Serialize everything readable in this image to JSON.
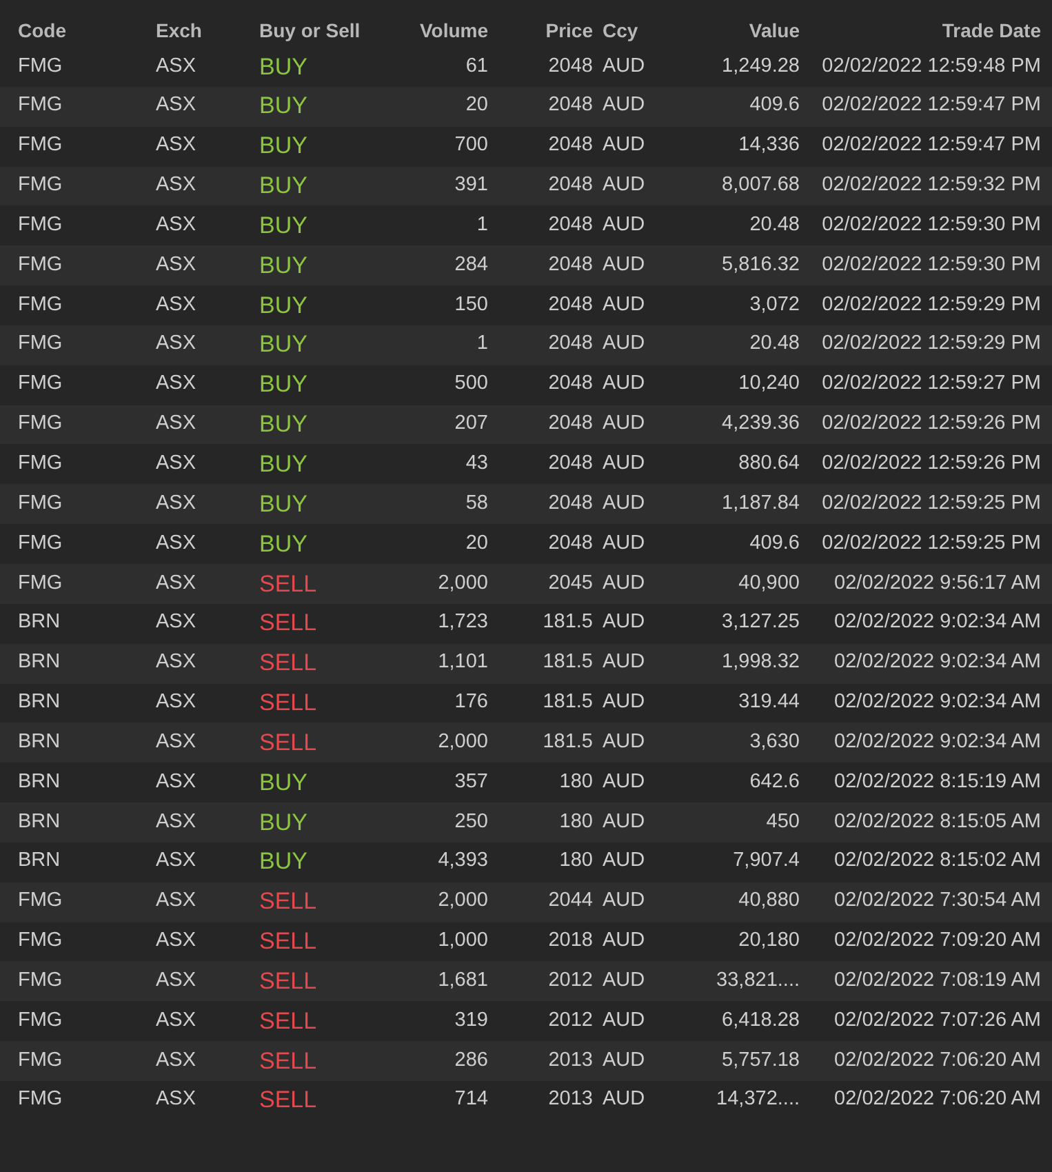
{
  "table": {
    "columns": [
      "Code",
      "Exch",
      "Buy or Sell",
      "Volume",
      "Price",
      "Ccy",
      "Value",
      "Trade Date"
    ],
    "rows": [
      {
        "code": "FMG",
        "exch": "ASX",
        "kind": "buy",
        "side": "BUY",
        "volume": "61",
        "price": "2048",
        "ccy": "AUD",
        "value": "1,249.28",
        "date": "02/02/2022 12:59:48 PM"
      },
      {
        "code": "FMG",
        "exch": "ASX",
        "kind": "buy",
        "side": "BUY",
        "volume": "20",
        "price": "2048",
        "ccy": "AUD",
        "value": "409.6",
        "date": "02/02/2022 12:59:47 PM"
      },
      {
        "code": "FMG",
        "exch": "ASX",
        "kind": "buy",
        "side": "BUY",
        "volume": "700",
        "price": "2048",
        "ccy": "AUD",
        "value": "14,336",
        "date": "02/02/2022 12:59:47 PM"
      },
      {
        "code": "FMG",
        "exch": "ASX",
        "kind": "buy",
        "side": "BUY",
        "volume": "391",
        "price": "2048",
        "ccy": "AUD",
        "value": "8,007.68",
        "date": "02/02/2022 12:59:32 PM"
      },
      {
        "code": "FMG",
        "exch": "ASX",
        "kind": "buy",
        "side": "BUY",
        "volume": "1",
        "price": "2048",
        "ccy": "AUD",
        "value": "20.48",
        "date": "02/02/2022 12:59:30 PM"
      },
      {
        "code": "FMG",
        "exch": "ASX",
        "kind": "buy",
        "side": "BUY",
        "volume": "284",
        "price": "2048",
        "ccy": "AUD",
        "value": "5,816.32",
        "date": "02/02/2022 12:59:30 PM"
      },
      {
        "code": "FMG",
        "exch": "ASX",
        "kind": "buy",
        "side": "BUY",
        "volume": "150",
        "price": "2048",
        "ccy": "AUD",
        "value": "3,072",
        "date": "02/02/2022 12:59:29 PM"
      },
      {
        "code": "FMG",
        "exch": "ASX",
        "kind": "buy",
        "side": "BUY",
        "volume": "1",
        "price": "2048",
        "ccy": "AUD",
        "value": "20.48",
        "date": "02/02/2022 12:59:29 PM"
      },
      {
        "code": "FMG",
        "exch": "ASX",
        "kind": "buy",
        "side": "BUY",
        "volume": "500",
        "price": "2048",
        "ccy": "AUD",
        "value": "10,240",
        "date": "02/02/2022 12:59:27 PM"
      },
      {
        "code": "FMG",
        "exch": "ASX",
        "kind": "buy",
        "side": "BUY",
        "volume": "207",
        "price": "2048",
        "ccy": "AUD",
        "value": "4,239.36",
        "date": "02/02/2022 12:59:26 PM"
      },
      {
        "code": "FMG",
        "exch": "ASX",
        "kind": "buy",
        "side": "BUY",
        "volume": "43",
        "price": "2048",
        "ccy": "AUD",
        "value": "880.64",
        "date": "02/02/2022 12:59:26 PM"
      },
      {
        "code": "FMG",
        "exch": "ASX",
        "kind": "buy",
        "side": "BUY",
        "volume": "58",
        "price": "2048",
        "ccy": "AUD",
        "value": "1,187.84",
        "date": "02/02/2022 12:59:25 PM"
      },
      {
        "code": "FMG",
        "exch": "ASX",
        "kind": "buy",
        "side": "BUY",
        "volume": "20",
        "price": "2048",
        "ccy": "AUD",
        "value": "409.6",
        "date": "02/02/2022 12:59:25 PM"
      },
      {
        "code": "FMG",
        "exch": "ASX",
        "kind": "sell",
        "side": "SELL",
        "volume": "2,000",
        "price": "2045",
        "ccy": "AUD",
        "value": "40,900",
        "date": "02/02/2022 9:56:17 AM"
      },
      {
        "code": "BRN",
        "exch": "ASX",
        "kind": "sell",
        "side": "SELL",
        "volume": "1,723",
        "price": "181.5",
        "ccy": "AUD",
        "value": "3,127.25",
        "date": "02/02/2022 9:02:34 AM"
      },
      {
        "code": "BRN",
        "exch": "ASX",
        "kind": "sell",
        "side": "SELL",
        "volume": "1,101",
        "price": "181.5",
        "ccy": "AUD",
        "value": "1,998.32",
        "date": "02/02/2022 9:02:34 AM"
      },
      {
        "code": "BRN",
        "exch": "ASX",
        "kind": "sell",
        "side": "SELL",
        "volume": "176",
        "price": "181.5",
        "ccy": "AUD",
        "value": "319.44",
        "date": "02/02/2022 9:02:34 AM"
      },
      {
        "code": "BRN",
        "exch": "ASX",
        "kind": "sell",
        "side": "SELL",
        "volume": "2,000",
        "price": "181.5",
        "ccy": "AUD",
        "value": "3,630",
        "date": "02/02/2022 9:02:34 AM"
      },
      {
        "code": "BRN",
        "exch": "ASX",
        "kind": "buy",
        "side": "BUY",
        "volume": "357",
        "price": "180",
        "ccy": "AUD",
        "value": "642.6",
        "date": "02/02/2022 8:15:19 AM"
      },
      {
        "code": "BRN",
        "exch": "ASX",
        "kind": "buy",
        "side": "BUY",
        "volume": "250",
        "price": "180",
        "ccy": "AUD",
        "value": "450",
        "date": "02/02/2022 8:15:05 AM"
      },
      {
        "code": "BRN",
        "exch": "ASX",
        "kind": "buy",
        "side": "BUY",
        "volume": "4,393",
        "price": "180",
        "ccy": "AUD",
        "value": "7,907.4",
        "date": "02/02/2022 8:15:02 AM"
      },
      {
        "code": "FMG",
        "exch": "ASX",
        "kind": "sell",
        "side": "SELL",
        "volume": "2,000",
        "price": "2044",
        "ccy": "AUD",
        "value": "40,880",
        "date": "02/02/2022 7:30:54 AM"
      },
      {
        "code": "FMG",
        "exch": "ASX",
        "kind": "sell",
        "side": "SELL",
        "volume": "1,000",
        "price": "2018",
        "ccy": "AUD",
        "value": "20,180",
        "date": "02/02/2022 7:09:20 AM"
      },
      {
        "code": "FMG",
        "exch": "ASX",
        "kind": "sell",
        "side": "SELL",
        "volume": "1,681",
        "price": "2012",
        "ccy": "AUD",
        "value": "33,821....",
        "date": "02/02/2022 7:08:19 AM"
      },
      {
        "code": "FMG",
        "exch": "ASX",
        "kind": "sell",
        "side": "SELL",
        "volume": "319",
        "price": "2012",
        "ccy": "AUD",
        "value": "6,418.28",
        "date": "02/02/2022 7:07:26 AM"
      },
      {
        "code": "FMG",
        "exch": "ASX",
        "kind": "sell",
        "side": "SELL",
        "volume": "286",
        "price": "2013",
        "ccy": "AUD",
        "value": "5,757.18",
        "date": "02/02/2022 7:06:20 AM"
      },
      {
        "code": "FMG",
        "exch": "ASX",
        "kind": "sell",
        "side": "SELL",
        "volume": "714",
        "price": "2013",
        "ccy": "AUD",
        "value": "14,372....",
        "date": "02/02/2022 7:06:20 AM"
      }
    ]
  }
}
